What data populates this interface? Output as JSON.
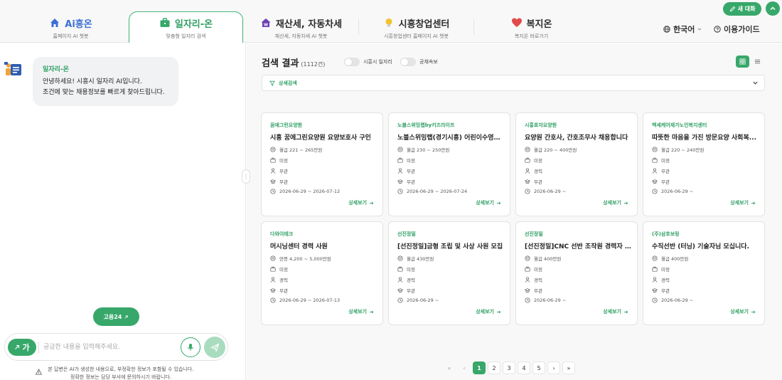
{
  "colors": {
    "accent": "#37a86a",
    "accent_text": "#2e9f63",
    "panel_bg": "#f7f8f7"
  },
  "tabs": [
    {
      "title": "Ai흥온",
      "subtitle": "홈페이지 AI 챗봇",
      "icon": "house-icon"
    },
    {
      "title": "일자리-온",
      "subtitle": "맞춤형 일자리 검색",
      "icon": "briefcase-icon"
    },
    {
      "title": "재산세, 자동차세",
      "subtitle": "재산세, 자동차세 AI 챗봇",
      "icon": "tax-house-icon"
    },
    {
      "title": "시흥창업센터",
      "subtitle": "시흥창업센터 홈페이지 AI 챗봇",
      "icon": "lightbulb-icon"
    },
    {
      "title": "복지온",
      "subtitle": "복지온 바로가기",
      "icon": "heart-icon"
    }
  ],
  "header": {
    "language": "한국어",
    "guide": "이용가이드",
    "new_chat": "새 대화"
  },
  "chat": {
    "bot_name": "일자리-온",
    "greeting_line1": "안녕하세요! 시흥시 일자리 AI입니다.",
    "greeting_line2": "조건에 맞는 채용정보를 빠르게 찾아드립니다.",
    "goyong_button": "고용24",
    "font_button": "가",
    "input_placeholder": "궁금한 내용을 입력해주세요.",
    "disclaimer_line1": "본 답변은 AI가 생성한 내용으로, 부정확한 정보가 포함될 수 있습니다.",
    "disclaimer_line2": "정확한 정보는 담당 부서에 문의하시기 바랍니다."
  },
  "results": {
    "title": "검색 결과",
    "count": "(1112건)",
    "toggle1": "시흥시 일자리",
    "toggle2": "공채속보",
    "filter_label": "상세검색",
    "more_label": "상세보기"
  },
  "cards": [
    {
      "company": "꿈에그린요양원",
      "title": "시흥 꿈에그린요양원 요양보호사 구인",
      "salary": "월급 221 ~ 265만원",
      "career": "미정",
      "education": "무관",
      "edu2": "무관",
      "period": "2026-06-29 ~ 2026-07-12"
    },
    {
      "company": "노블스위밍랩by키즈라이프",
      "title": "노블스위밍랩(경기시흥) 어린이수영장 ...",
      "salary": "월급 230 ~ 250만원",
      "career": "미정",
      "education": "무관",
      "edu2": "무관",
      "period": "2026-06-29 ~ 2026-07-24"
    },
    {
      "company": "시흥효자요양원",
      "title": "요양원 간호사, 간호조무사 채용합니다",
      "salary": "월급 220 ~ 400만원",
      "career": "미정",
      "education": "경력",
      "edu2": "무관",
      "period": "2026-06-29 ~"
    },
    {
      "company": "백세케어재가노인복지센터",
      "title": "따뜻한 마음을 가진 방문요양 사회복...",
      "salary": "월급 220 ~ 240만원",
      "career": "미정",
      "education": "무관",
      "edu2": "무관",
      "period": "2026-06-29 ~"
    },
    {
      "company": "다와이테크",
      "title": "머시닝센터 경력 사원",
      "salary": "연봉 4,200 ~ 5,000만원",
      "career": "미정",
      "education": "경력",
      "edu2": "무관",
      "period": "2026-06-29 ~ 2026-07-13"
    },
    {
      "company": "선진정밀",
      "title": "[선진정밀]금형 조립 및 사상 사원 모집",
      "salary": "월급 430만원",
      "career": "미정",
      "education": "경력",
      "edu2": "무관",
      "period": "2026-06-29 ~"
    },
    {
      "company": "선진정밀",
      "title": "[선진정밀]CNC 선반 조작원 경력자 ...",
      "salary": "월급 400만원",
      "career": "미정",
      "education": "경력",
      "edu2": "무관",
      "period": "2026-06-29 ~"
    },
    {
      "company": "(주)삼호보링",
      "title": "수직선반 (터닝) 기술자님 모십니다.",
      "salary": "월급 400만원",
      "career": "미정",
      "education": "경력",
      "edu2": "무관",
      "period": "2026-06-29 ~"
    }
  ],
  "pagination": {
    "pages": [
      "1",
      "2",
      "3",
      "4",
      "5"
    ],
    "current": "1",
    "first": "«",
    "prev": "‹",
    "next": "›",
    "last": "»"
  }
}
